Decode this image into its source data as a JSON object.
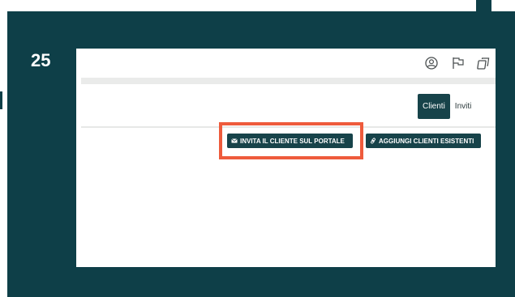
{
  "step": {
    "number": "25"
  },
  "header_icons": [
    {
      "name": "user-circle-icon"
    },
    {
      "name": "flag-icon"
    },
    {
      "name": "copy-icon"
    }
  ],
  "tabs": [
    {
      "label": "Clienti",
      "active": true
    },
    {
      "label": "Inviti",
      "active": false
    }
  ],
  "actions": {
    "invite_label": "INVITA IL CLIENTE SUL PORTALE",
    "invite_icon": "envelope-icon",
    "add_label": "AGGIUNGI CLIENTI ESISTENTI",
    "add_icon": "link-icon"
  },
  "colors": {
    "frame": "#0e3f48",
    "button": "#17434a",
    "highlight": "#ee5b3c"
  }
}
